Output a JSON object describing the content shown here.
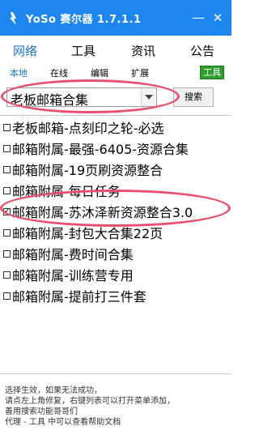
{
  "window": {
    "title": "YoSo 赛尔器  1.7.1.1",
    "min_label": "—",
    "close_label": "✕"
  },
  "tabs": [
    "网络",
    "工具",
    "资讯",
    "公告"
  ],
  "subnav": {
    "items": [
      "本地",
      "在线",
      "编辑",
      "扩展"
    ],
    "tag": "工具"
  },
  "search": {
    "selected": "老板邮箱合集",
    "button_label": "搜索"
  },
  "list": {
    "items": [
      {
        "label": "老板邮箱-点刻印之轮-必选",
        "checked": false
      },
      {
        "label": "邮箱附属-最强-6405-资源合集",
        "checked": false
      },
      {
        "label": "邮箱附属-19页刷资源整合",
        "checked": false
      },
      {
        "label": "邮箱附属-每日任务",
        "checked": false
      },
      {
        "label": "邮箱附属-苏沐泽新资源整合3.0",
        "checked": true
      },
      {
        "label": "邮箱附属-封包大合集22页",
        "checked": false
      },
      {
        "label": "邮箱附属-费时间合集",
        "checked": false
      },
      {
        "label": "邮箱附属-训练营专用",
        "checked": false
      },
      {
        "label": "邮箱附属-提前打三件套",
        "checked": false
      }
    ]
  },
  "help": {
    "line1": "选择生效，如果无法成功，",
    "line2": "请点左上角修复，右键列表可以打开菜单添加，",
    "line3": "善用搜索功能哥哥们",
    "line4": "代理 - 工具 中可以查看帮助文档"
  },
  "colors": {
    "titlebar": "#1e86f0",
    "accent_tab": "#1e73c8",
    "highlight_oval": "#e8506f",
    "tag_green": "#2e9e2e"
  }
}
